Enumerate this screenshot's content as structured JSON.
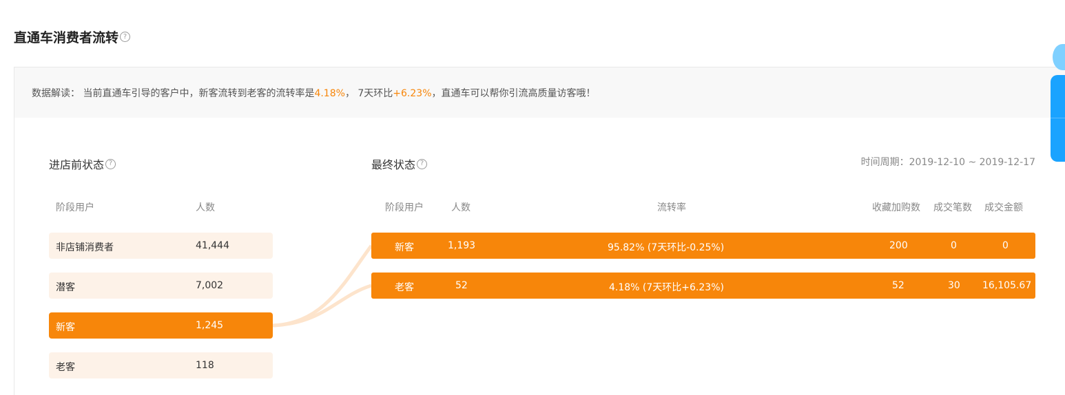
{
  "header": {
    "title": "直通车消费者流转",
    "help_icon": "question-circle-icon"
  },
  "insight": {
    "prefix": "数据解读： 当前直通车引导的客户中，新客流转到老客的流转率是",
    "rate": "4.18%",
    "mid": "， 7天环比",
    "change": "+6.23%",
    "suffix": "，直通车可以帮你引流高质量访客哦！"
  },
  "before": {
    "title": "进店前状态",
    "columns": [
      "阶段用户",
      "人数"
    ],
    "rows": [
      {
        "stage": "非店铺消费者",
        "count": "41,444"
      },
      {
        "stage": "潜客",
        "count": "7,002"
      },
      {
        "stage": "新客",
        "count": "1,245"
      },
      {
        "stage": "老客",
        "count": "118"
      }
    ]
  },
  "final": {
    "title": "最终状态",
    "period": "时间周期：2019-12-10 ~ 2019-12-17",
    "columns": [
      "阶段用户",
      "人数",
      "流转率",
      "收藏加购数",
      "成交笔数",
      "成交金额"
    ],
    "rows": [
      {
        "stage": "新客",
        "count": "1,193",
        "rate": "95.82%   (7天环比-0.25%)",
        "fav": "200",
        "orders": "0",
        "amount": "0"
      },
      {
        "stage": "老客",
        "count": "52",
        "rate": "4.18%   (7天环比+6.23%)",
        "fav": "52",
        "orders": "30",
        "amount": "16,105.67"
      }
    ]
  },
  "colors": {
    "accent": "#f7860a",
    "light_row": "#fdf2e8",
    "flow": "#fde4cc",
    "side_widget": "#1aa3ff"
  }
}
